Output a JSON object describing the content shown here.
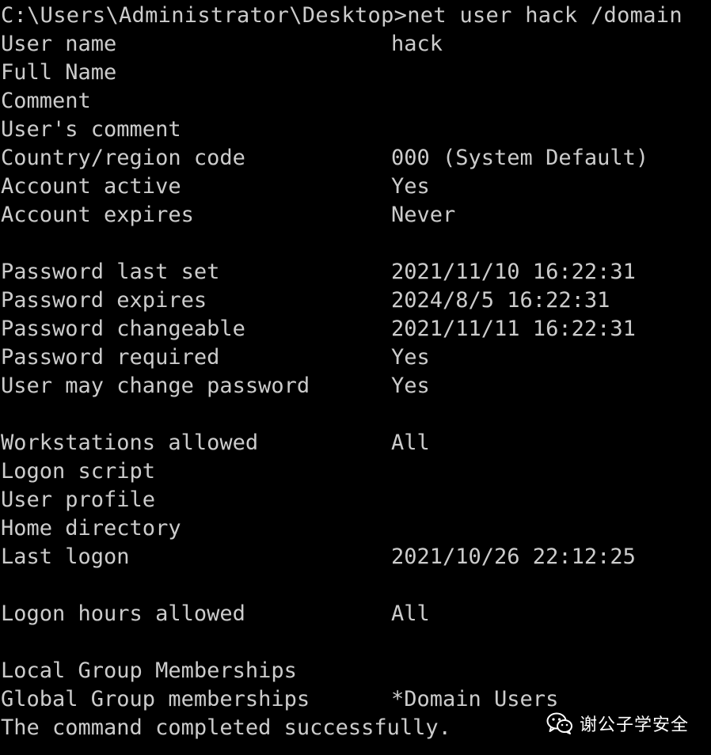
{
  "terminal": {
    "prompt": "C:\\Users\\Administrator\\Desktop>",
    "command": "net user hack /domain",
    "rows": [
      {
        "field": "User name",
        "value": "hack"
      },
      {
        "field": "Full Name",
        "value": ""
      },
      {
        "field": "Comment",
        "value": ""
      },
      {
        "field": "User's comment",
        "value": ""
      },
      {
        "field": "Country/region code",
        "value": "000 (System Default)"
      },
      {
        "field": "Account active",
        "value": "Yes"
      },
      {
        "field": "Account expires",
        "value": "Never"
      },
      {
        "field": "",
        "value": ""
      },
      {
        "field": "Password last set",
        "value": "2021/11/10 16:22:31"
      },
      {
        "field": "Password expires",
        "value": "2024/8/5 16:22:31"
      },
      {
        "field": "Password changeable",
        "value": "2021/11/11 16:22:31"
      },
      {
        "field": "Password required",
        "value": "Yes"
      },
      {
        "field": "User may change password",
        "value": "Yes"
      },
      {
        "field": "",
        "value": ""
      },
      {
        "field": "Workstations allowed",
        "value": "All"
      },
      {
        "field": "Logon script",
        "value": ""
      },
      {
        "field": "User profile",
        "value": ""
      },
      {
        "field": "Home directory",
        "value": ""
      },
      {
        "field": "Last logon",
        "value": "2021/10/26 22:12:25"
      },
      {
        "field": "",
        "value": ""
      },
      {
        "field": "Logon hours allowed",
        "value": "All"
      },
      {
        "field": "",
        "value": ""
      },
      {
        "field": "Local Group Memberships",
        "value": ""
      },
      {
        "field": "Global Group memberships",
        "value": "*Domain Users"
      }
    ],
    "completion": "The command completed successfully."
  },
  "watermark": {
    "icon": "wechat-icon",
    "text": "谢公子学安全"
  },
  "colors": {
    "background": "#000000",
    "foreground": "#cccccc"
  }
}
